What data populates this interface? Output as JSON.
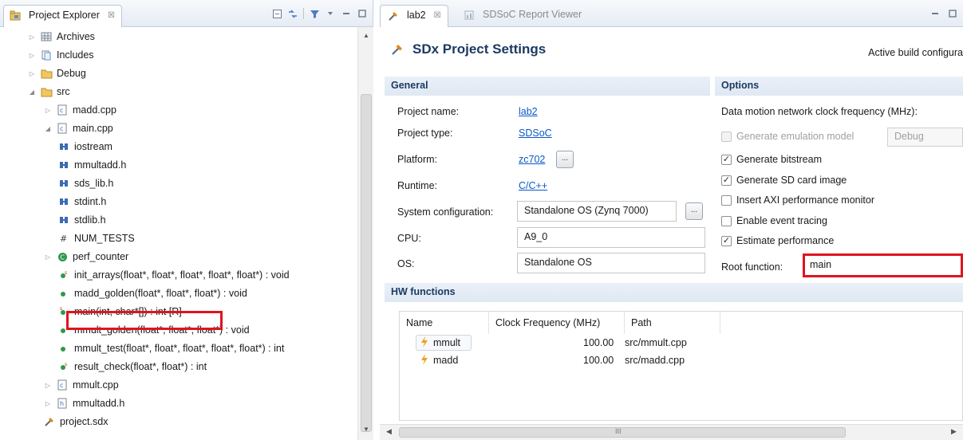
{
  "explorer": {
    "tab_label": "Project Explorer",
    "tab_close": "☒",
    "tree": [
      {
        "label": "Archives",
        "icon": "archive-icon",
        "depth": 1,
        "twisty": "▷"
      },
      {
        "label": "Includes",
        "icon": "includes-icon",
        "depth": 1,
        "twisty": "▷"
      },
      {
        "label": "Debug",
        "icon": "folder-icon",
        "depth": 1,
        "twisty": "▷"
      },
      {
        "label": "src",
        "icon": "folder-icon",
        "depth": 0,
        "twisty": "◢"
      },
      {
        "label": "madd.cpp",
        "icon": "cpp-file-icon",
        "depth": 2,
        "twisty": "▷"
      },
      {
        "label": "main.cpp",
        "icon": "cpp-file-icon",
        "depth": 2,
        "twisty": "◢"
      },
      {
        "label": "iostream",
        "icon": "include-icon",
        "depth": 3,
        "twisty": ""
      },
      {
        "label": "mmultadd.h",
        "icon": "include-icon",
        "depth": 3,
        "twisty": ""
      },
      {
        "label": "sds_lib.h",
        "icon": "include-icon",
        "depth": 3,
        "twisty": ""
      },
      {
        "label": "stdint.h",
        "icon": "include-icon",
        "depth": 3,
        "twisty": ""
      },
      {
        "label": "stdlib.h",
        "icon": "include-icon",
        "depth": 3,
        "twisty": ""
      },
      {
        "label": "NUM_TESTS",
        "icon": "macro-icon",
        "depth": 3,
        "twisty": ""
      },
      {
        "label": "perf_counter",
        "icon": "class-icon",
        "depth": 3,
        "twisty": "▷"
      },
      {
        "label": "init_arrays(float*, float*, float*, float*, float*) : void",
        "icon": "function-static-icon",
        "depth": 3,
        "twisty": ""
      },
      {
        "label": "madd_golden(float*, float*, float*) : void",
        "icon": "function-icon",
        "depth": 3,
        "twisty": ""
      },
      {
        "label": "main(int, char*[]) : int [R]",
        "icon": "function-root-icon",
        "depth": 3,
        "twisty": ""
      },
      {
        "label": "mmult_golden(float*, float*, float*) : void",
        "icon": "function-icon",
        "depth": 3,
        "twisty": ""
      },
      {
        "label": "mmult_test(float*, float*, float*, float*, float*) : int",
        "icon": "function-icon",
        "depth": 3,
        "twisty": ""
      },
      {
        "label": "result_check(float*, float*) : int",
        "icon": "function-static-icon",
        "depth": 3,
        "twisty": ""
      },
      {
        "label": "mmult.cpp",
        "icon": "cpp-file-icon",
        "depth": 2,
        "twisty": "▷"
      },
      {
        "label": "mmultadd.h",
        "icon": "header-file-icon",
        "depth": 2,
        "twisty": "▷"
      },
      {
        "label": "project.sdx",
        "icon": "sdx-file-icon",
        "depth": 2,
        "twisty": ""
      }
    ]
  },
  "editor": {
    "tabs": [
      {
        "label": "lab2",
        "close": "☒"
      },
      {
        "label": "SDSoC Report Viewer"
      }
    ],
    "title": "SDx Project Settings",
    "active_build": "Active build configura",
    "general": {
      "heading": "General",
      "project_name_label": "Project name:",
      "project_name": "lab2",
      "project_type_label": "Project type:",
      "project_type": "SDSoC",
      "platform_label": "Platform:",
      "platform": "zc702",
      "runtime_label": "Runtime:",
      "runtime": "C/C++",
      "sysconfig_label": "System configuration:",
      "sysconfig": "Standalone OS (Zynq 7000)",
      "cpu_label": "CPU:",
      "cpu": "A9_0",
      "os_label": "OS:",
      "os": "Standalone OS",
      "dots": "..."
    },
    "options": {
      "heading": "Options",
      "clock_label": "Data motion network clock frequency (MHz):",
      "emulation_label": "Generate emulation model",
      "emulation_select": "Debug",
      "bitstream_label": "Generate bitstream",
      "sdcard_label": "Generate SD card image",
      "axi_label": "Insert AXI performance monitor",
      "event_label": "Enable event tracing",
      "estimate_label": "Estimate performance",
      "root_label": "Root function:",
      "root_value": "main",
      "check": "✓"
    },
    "hw": {
      "heading": "HW functions",
      "columns": [
        "Name",
        "Clock Frequency (MHz)",
        "Path"
      ],
      "rows": [
        {
          "name": "mmult",
          "freq": "100.00",
          "path": "src/mmult.cpp"
        },
        {
          "name": "madd",
          "freq": "100.00",
          "path": "src/madd.cpp"
        }
      ],
      "scroll_mark": "III"
    }
  },
  "colors": {
    "accent": "#1b3a63",
    "link": "#0a58c8",
    "highlight": "#e0141e"
  }
}
